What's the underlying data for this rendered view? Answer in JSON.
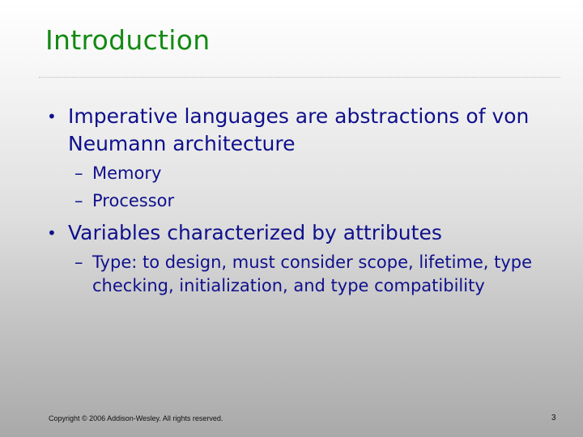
{
  "slide": {
    "title": "Introduction",
    "bullets": [
      {
        "marker": "•",
        "text": "Imperative languages are abstractions of von Neumann architecture",
        "sub": [
          {
            "marker": "–",
            "text": "Memory"
          },
          {
            "marker": "–",
            "text": "Processor"
          }
        ]
      },
      {
        "marker": "•",
        "text": "Variables characterized by attributes",
        "sub": [
          {
            "marker": "–",
            "text": "Type: to design, must consider scope, lifetime, type checking, initialization, and type compatibility"
          }
        ]
      }
    ],
    "footer": "Copyright © 2006 Addison-Wesley. All rights reserved.",
    "page_number": "3"
  },
  "colors": {
    "title": "#138a13",
    "body_text": "#10108c"
  }
}
